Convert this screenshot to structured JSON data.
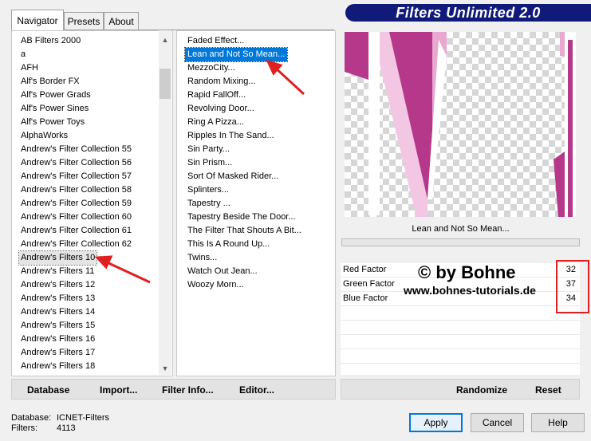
{
  "tabs": {
    "navigator": "Navigator",
    "presets": "Presets",
    "about": "About"
  },
  "banner": {
    "title": "Filters Unlimited 2.0"
  },
  "categories": [
    "AB Filters 2000",
    "a",
    "AFH",
    "Alf's Border FX",
    "Alf's Power Grads",
    "Alf's Power Sines",
    "Alf's Power Toys",
    "AlphaWorks",
    "Andrew's Filter Collection 55",
    "Andrew's Filter Collection 56",
    "Andrew's Filter Collection 57",
    "Andrew's Filter Collection 58",
    "Andrew's Filter Collection 59",
    "Andrew's Filter Collection 60",
    "Andrew's Filter Collection 61",
    "Andrew's Filter Collection 62",
    "Andrew's Filters 10",
    "Andrew's Filters 11",
    "Andrew's Filters 12",
    "Andrew's Filters 13",
    "Andrew's Filters 14",
    "Andrew's Filters 15",
    "Andrew's Filters 16",
    "Andrew's Filters 17",
    "Andrew's Filters 18"
  ],
  "selected_category": "Andrew's Filters 10",
  "filters": [
    "Faded Effect...",
    "Lean and Not So Mean...",
    "MezzoCity...",
    "Random Mixing...",
    "Rapid FallOff...",
    "Revolving Door...",
    "Ring A Pizza...",
    "Ripples In The Sand...",
    "Sin Party...",
    "Sin Prism...",
    "Sort Of Masked Rider...",
    "Splinters...",
    "Tapestry ...",
    "Tapestry Beside The Door...",
    "The Filter That Shouts A Bit...",
    "This Is A Round Up...",
    "Twins...",
    "Watch Out Jean...",
    "Woozy Morn..."
  ],
  "selected_filter": "Lean and Not So Mean...",
  "preview_filter_name": "Lean and Not So Mean...",
  "params": [
    {
      "label": "Red Factor",
      "value": "32"
    },
    {
      "label": "Green Factor",
      "value": "37"
    },
    {
      "label": "Blue Factor",
      "value": "34"
    }
  ],
  "watermark": {
    "line1": "© by Bohne",
    "line2": "www.bohnes-tutorials.de"
  },
  "bottom_buttons": {
    "database": "Database",
    "import": "Import...",
    "filter_info": "Filter Info...",
    "editor": "Editor...",
    "randomize": "Randomize",
    "reset": "Reset"
  },
  "status": {
    "database_label": "Database:",
    "database_value": "ICNET-Filters",
    "filters_label": "Filters:",
    "filters_value": "4113"
  },
  "dialog_buttons": {
    "apply": "Apply",
    "cancel": "Cancel",
    "help": "Help"
  },
  "colors": {
    "selection": "#0078d7",
    "banner": "#101a78",
    "annotation_red": "#e02020",
    "preview_magenta": "#b5388a",
    "preview_pink": "#e8a8d0"
  },
  "icons": {
    "scroll_up": "▲",
    "scroll_down": "▼"
  }
}
